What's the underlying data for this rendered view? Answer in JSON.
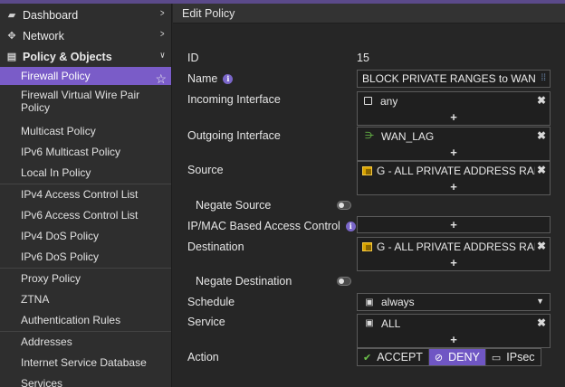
{
  "sidebar": {
    "top_items": [
      {
        "label": "Dashboard",
        "icon": "dashboard-icon"
      },
      {
        "label": "Network",
        "icon": "network-icon"
      },
      {
        "label": "Policy & Objects",
        "icon": "policy-icon"
      }
    ],
    "sub_items": [
      "Firewall Policy",
      "Firewall Virtual Wire Pair Policy",
      "Multicast Policy",
      "IPv6 Multicast Policy",
      "Local In Policy",
      "IPv4 Access Control List",
      "IPv6 Access Control List",
      "IPv4 DoS Policy",
      "IPv6 DoS Policy",
      "Proxy Policy",
      "ZTNA",
      "Authentication Rules",
      "Addresses",
      "Internet Service Database",
      "Services"
    ]
  },
  "main": {
    "header": "Edit Policy",
    "labels": {
      "id": "ID",
      "name": "Name",
      "incoming": "Incoming Interface",
      "outgoing": "Outgoing Interface",
      "source": "Source",
      "negate_source": "Negate Source",
      "ipmac": "IP/MAC Based Access Control",
      "destination": "Destination",
      "negate_destination": "Negate Destination",
      "schedule": "Schedule",
      "service": "Service",
      "action": "Action"
    },
    "values": {
      "id": "15",
      "name": "BLOCK PRIVATE RANGES to WAN",
      "incoming": "any",
      "outgoing": "WAN_LAG",
      "source": "G - ALL PRIVATE ADDRESS RANGES",
      "destination": "G - ALL PRIVATE ADDRESS RANGES",
      "schedule": "always",
      "service": "ALL"
    },
    "action_options": [
      "ACCEPT",
      "DENY",
      "IPsec"
    ],
    "action_selected": "DENY",
    "plus": "+",
    "remove": "✖"
  }
}
